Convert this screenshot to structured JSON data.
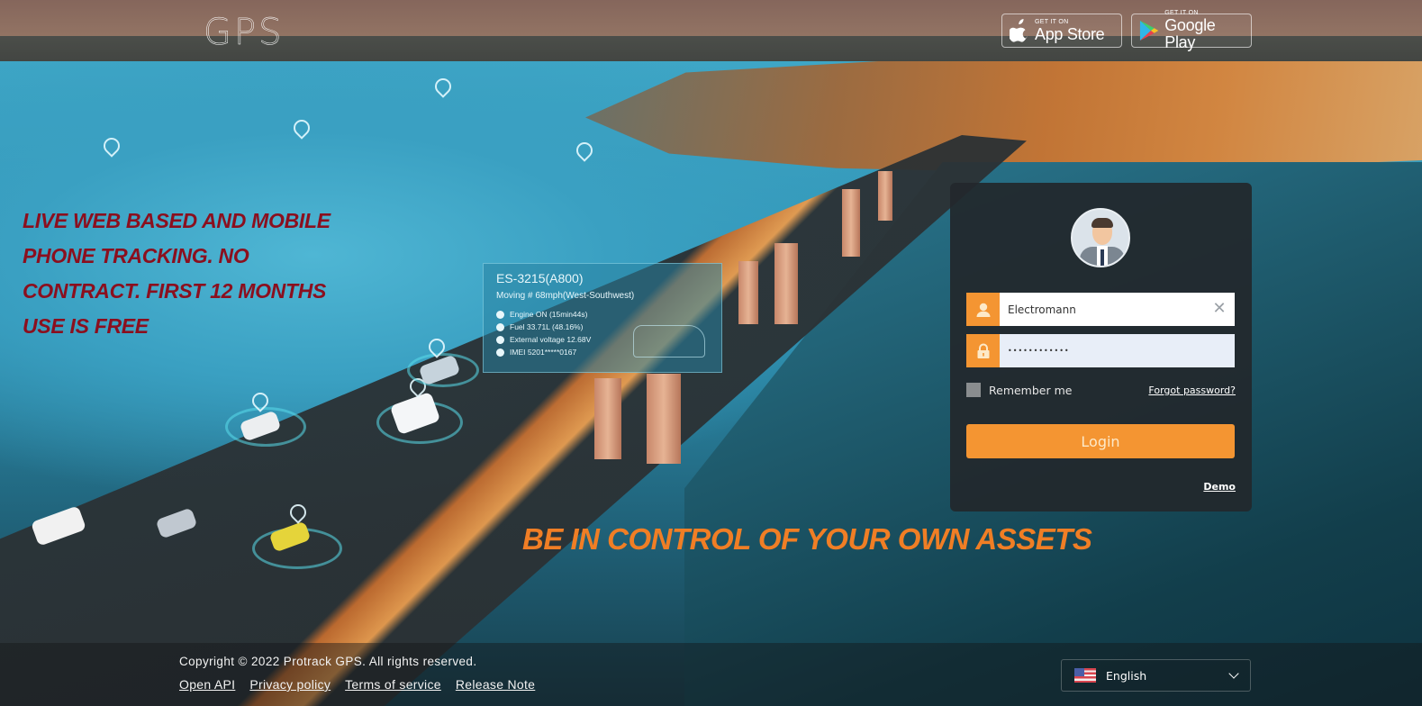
{
  "header": {
    "logo_text": "GPS",
    "app_store": {
      "small": "GET IT ON",
      "big": "App Store",
      "icon": "apple-icon"
    },
    "google_play": {
      "small": "GET IT ON",
      "big": "Google Play",
      "icon": "google-play-icon"
    }
  },
  "promo": {
    "left_lines": [
      "LIVE WEB BASED AND MOBILE",
      "PHONE TRACKING. NO",
      "CONTRACT. FIRST 12 MONTHS",
      "USE IS FREE"
    ],
    "bottom": "BE IN CONTROL OF YOUR OWN ASSETS",
    "left_color": "#8b0f1e",
    "bottom_color": "#f07e25"
  },
  "tracking_card": {
    "title": "ES-3215(A800)",
    "status": "Moving # 68mph(West-Southwest)",
    "rows": [
      {
        "icon": "engine-icon",
        "text": "Engine ON  (15min44s)"
      },
      {
        "icon": "fuel-icon",
        "text": "Fuel 33.71L (48.16%)"
      },
      {
        "icon": "voltage-icon",
        "text": "External voltage 12.68V"
      },
      {
        "icon": "imei-icon",
        "text": "IMEI 5201*****0167"
      }
    ]
  },
  "login": {
    "username_value": "Electromann",
    "password_value": "••••••••••••",
    "remember_label": "Remember me",
    "remember_checked": false,
    "forgot_label": "Forgot password?",
    "login_label": "Login",
    "demo_label": "Demo",
    "accent_color": "#f49532"
  },
  "footer": {
    "copyright": "Copyright © 2022 Protrack GPS. All rights reserved.",
    "links": [
      "Open API",
      "Privacy policy",
      "Terms of service",
      "Release Note"
    ],
    "language": "English"
  }
}
